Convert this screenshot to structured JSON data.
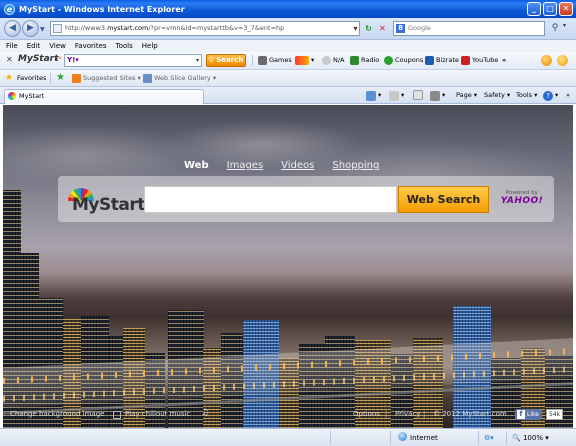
{
  "window": {
    "title": "MyStart - Windows Internet Explorer",
    "minimize": "_",
    "maximize": "□",
    "close": "✕"
  },
  "address_bar": {
    "url_prefix": "http://www3.",
    "url_domain": "mystart.com",
    "url_suffix": "/?pr=vmn&id=mystarttb&v=3_7&ent=hp",
    "search_placeholder": "Google"
  },
  "menu": [
    "File",
    "Edit",
    "View",
    "Favorites",
    "Tools",
    "Help"
  ],
  "toolbar": {
    "logo": "MyStart",
    "search_button": "Search",
    "items": [
      {
        "label": "Games",
        "color": "#6a6a6a"
      },
      {
        "label": "N/A",
        "color": "#9a9a9a"
      },
      {
        "label": "Radio",
        "color": "#2d8a2d"
      },
      {
        "label": "Coupons",
        "color": "#2aa02a"
      },
      {
        "label": "Bizrate",
        "color": "#1f5bb5"
      },
      {
        "label": "YouTube",
        "color": "#cc1f1f"
      }
    ],
    "more": "»"
  },
  "favorites_bar": {
    "favorites_label": "Favorites",
    "links": [
      {
        "label": "Suggested Sites ▾",
        "color": "#f07d1a"
      },
      {
        "label": "Web Slice Gallery ▾",
        "color": "#6a8fc4"
      }
    ]
  },
  "tab": {
    "title": "MyStart"
  },
  "command_bar": {
    "page": "Page ▾",
    "safety": "Safety ▾",
    "tools": "Tools ▾",
    "help": "?"
  },
  "search_ui": {
    "tabs": [
      "Web",
      "Images",
      "Videos",
      "Shopping"
    ],
    "active_tab": "Web",
    "logo_text": "MyStart",
    "button": "Web Search",
    "powered_by": "Powered by",
    "provider": "YAHOO!"
  },
  "footer": {
    "change_background": "Change background image",
    "play_music": "Play chillout music",
    "options": "Options",
    "privacy": "Privacy",
    "copyright": "© 2012 MyStart.com",
    "fb_like": "Like",
    "fb_count": "54k"
  },
  "status_bar": {
    "zone": "Internet",
    "zoom": "100%"
  },
  "colors": {
    "titlebar": "#0a5fe4",
    "accent_orange": "#f59d00",
    "yahoo_purple": "#7b0099"
  }
}
